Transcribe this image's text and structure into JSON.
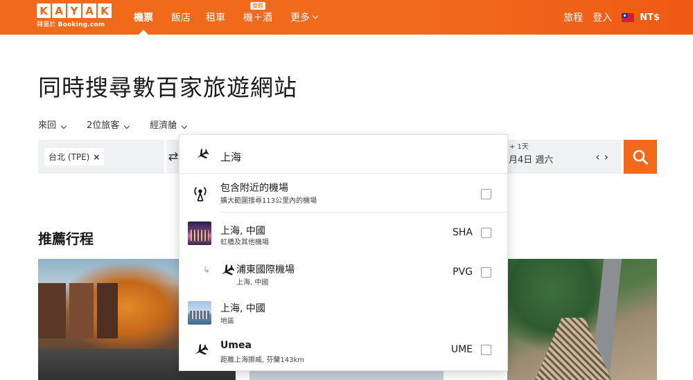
{
  "brand": {
    "letters": [
      "K",
      "A",
      "Y",
      "A",
      "K"
    ],
    "sub_prefix": "隸屬於",
    "sub_brand": "Booking.com"
  },
  "nav": {
    "items": [
      {
        "label": "機票",
        "active": true
      },
      {
        "label": "飯店",
        "active": false
      },
      {
        "label": "租車",
        "active": false
      },
      {
        "label": "機＋酒",
        "active": false,
        "badge": "度假"
      },
      {
        "label": "更多",
        "active": false,
        "has_dropdown": true
      }
    ]
  },
  "header_right": {
    "trips": "旅程",
    "login": "登入",
    "currency": "NT$"
  },
  "hero": {
    "title": "同時搜尋數百家旅遊網站"
  },
  "options": {
    "trip_type": "來回",
    "travelers": "2位旅客",
    "cabin": "經濟艙"
  },
  "search": {
    "origin_chip": "台北 (TPE)",
    "origin_remove": "×",
    "swap_icon": "⇄",
    "date_flex": "+ 1天",
    "date_value": "月4日 週六",
    "date_prev": "‹",
    "date_next": "›"
  },
  "recommendations": {
    "title": "推薦行程"
  },
  "dropdown": {
    "query": "上海",
    "nearby": {
      "title": "包含附近的機場",
      "subtitle": "擴大範圍搜尋113公里內的機場"
    },
    "results": [
      {
        "title": "上海, 中國",
        "subtitle": "虹橋及其他機場",
        "code": "SHA",
        "kind": "city",
        "has_checkbox": true
      },
      {
        "title": "浦東國際機場",
        "subtitle": "上海, 中國",
        "code": "PVG",
        "kind": "airport-child",
        "has_checkbox": true
      },
      {
        "title": "上海, 中國",
        "subtitle": "地區",
        "code": "",
        "kind": "region",
        "has_checkbox": false
      },
      {
        "title": "Umea",
        "subtitle": "距離上海挪威, 芬蘭143km",
        "code": "UME",
        "kind": "airport",
        "has_checkbox": true
      }
    ]
  },
  "colors": {
    "brand_orange": "#f26a1b",
    "field_bg": "#f0f1f3"
  }
}
